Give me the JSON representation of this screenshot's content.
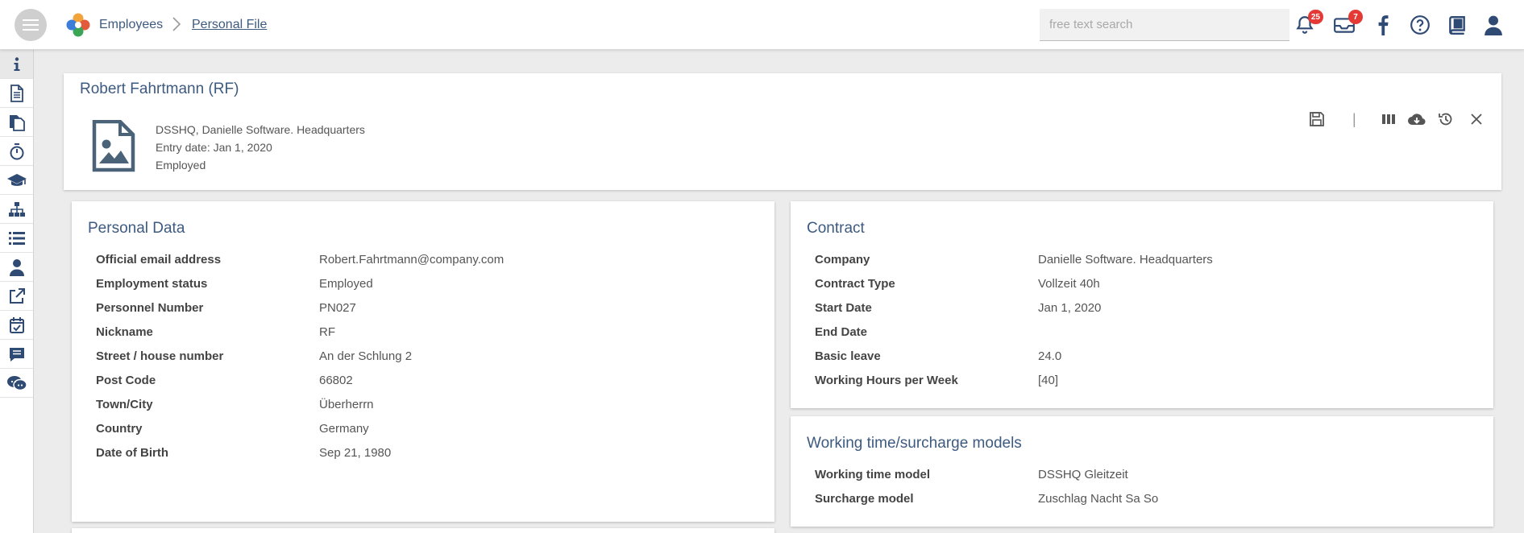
{
  "topbar": {
    "breadcrumb": [
      "Employees",
      "Personal File"
    ],
    "search_placeholder": "free text search",
    "notifications_count": "25",
    "messages_count": "7"
  },
  "sidebar": {
    "items": [
      "info-icon",
      "document-icon",
      "documents-icon",
      "stopwatch-icon",
      "graduation-cap-icon",
      "org-chart-icon",
      "list-icon",
      "person-icon",
      "external-link-icon",
      "calendar-check-icon",
      "comment-list-icon",
      "chat-icon"
    ]
  },
  "employee": {
    "name": "Robert Fahrtmann (RF)",
    "location": "DSSHQ, Danielle Software. Headquarters",
    "entry_date": "Entry date: Jan 1, 2020",
    "status": "Employed"
  },
  "personal_data": {
    "title": "Personal Data",
    "rows": [
      {
        "label": "Official email address",
        "value": "Robert.Fahrtmann@company.com"
      },
      {
        "label": "Employment status",
        "value": "Employed"
      },
      {
        "label": "Personnel Number",
        "value": "PN027"
      },
      {
        "label": "Nickname",
        "value": "RF"
      },
      {
        "label": "Street / house number",
        "value": "An der Schlung 2"
      },
      {
        "label": "Post Code",
        "value": "66802"
      },
      {
        "label": "Town/City",
        "value": "Überherrn"
      },
      {
        "label": "Country",
        "value": "Germany"
      },
      {
        "label": "Date of Birth",
        "value": "Sep 21, 1980"
      }
    ]
  },
  "contract": {
    "title": "Contract",
    "rows": [
      {
        "label": "Company",
        "value": "Danielle Software. Headquarters"
      },
      {
        "label": "Contract Type",
        "value": "Vollzeit 40h"
      },
      {
        "label": "Start Date",
        "value": "Jan 1, 2020"
      },
      {
        "label": "End Date",
        "value": ""
      },
      {
        "label": "Basic leave",
        "value": "24.0"
      },
      {
        "label": "Working Hours per Week",
        "value": "[40]"
      }
    ]
  },
  "working_time": {
    "title": "Working time/surcharge models",
    "rows": [
      {
        "label": "Working time model",
        "value": "DSSHQ Gleitzeit"
      },
      {
        "label": "Surcharge model",
        "value": "Zuschlag Nacht Sa So"
      }
    ]
  },
  "colors": {
    "accent": "#3d5a80",
    "icon": "#2f4a73",
    "badge": "#e53935"
  }
}
